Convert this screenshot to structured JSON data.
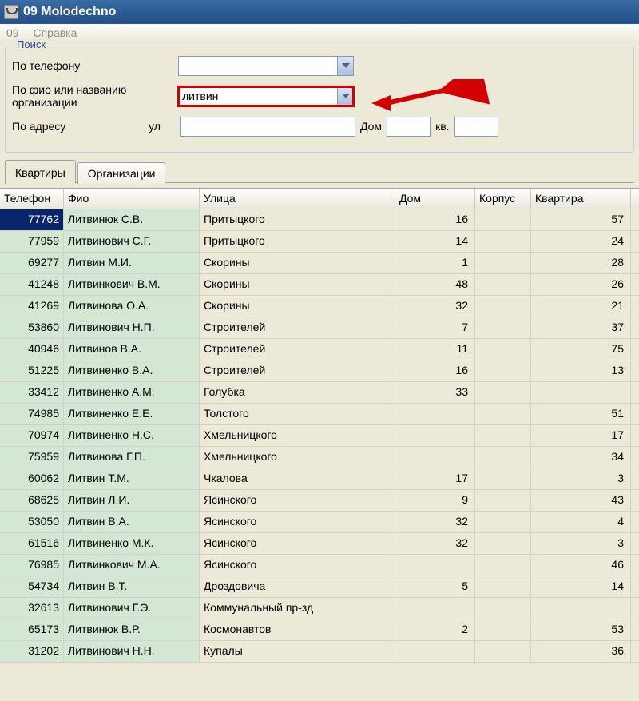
{
  "window": {
    "title": "09 Molodechno"
  },
  "menu": {
    "item_09": "09",
    "item_help": "Справка"
  },
  "search": {
    "legend": "Поиск",
    "by_phone_label": "По телефону",
    "by_phone_value": "",
    "by_name_label": "По фио или названию организации",
    "by_name_value": "литвин",
    "by_address_label": "По адресу",
    "street_prefix": "ул",
    "street_value": "",
    "house_label": "Дом",
    "house_value": "",
    "apt_label": "кв.",
    "apt_value": ""
  },
  "tabs": {
    "apartments": "Квартиры",
    "organizations": "Организации"
  },
  "columns": {
    "tel": "Телефон",
    "fio": "Фио",
    "street": "Улица",
    "dom": "Дом",
    "korp": "Корпус",
    "kv": "Квартира"
  },
  "rows": [
    {
      "tel": "77762",
      "fio": "Литвинюк С.В.",
      "street": "Притыцкого",
      "dom": "16",
      "korp": "",
      "kv": "57",
      "selected": true
    },
    {
      "tel": "77959",
      "fio": "Литвинович С.Г.",
      "street": "Притыцкого",
      "dom": "14",
      "korp": "",
      "kv": "24"
    },
    {
      "tel": "69277",
      "fio": "Литвин М.И.",
      "street": "Скорины",
      "dom": "1",
      "korp": "",
      "kv": "28"
    },
    {
      "tel": "41248",
      "fio": "Литвинкович В.М.",
      "street": "Скорины",
      "dom": "48",
      "korp": "",
      "kv": "26"
    },
    {
      "tel": "41269",
      "fio": "Литвинова О.А.",
      "street": "Скорины",
      "dom": "32",
      "korp": "",
      "kv": "21"
    },
    {
      "tel": "53860",
      "fio": "Литвинович Н.П.",
      "street": "Строителей",
      "dom": "7",
      "korp": "",
      "kv": "37"
    },
    {
      "tel": "40946",
      "fio": "Литвинов В.А.",
      "street": "Строителей",
      "dom": "11",
      "korp": "",
      "kv": "75"
    },
    {
      "tel": "51225",
      "fio": "Литвиненко В.А.",
      "street": "Строителей",
      "dom": "16",
      "korp": "",
      "kv": "13"
    },
    {
      "tel": "33412",
      "fio": "Литвиненко А.М.",
      "street": "Голубка",
      "dom": "33",
      "korp": "",
      "kv": ""
    },
    {
      "tel": "74985",
      "fio": "Литвиненко Е.Е.",
      "street": "Толстого",
      "dom": "",
      "korp": "",
      "kv": "51"
    },
    {
      "tel": "70974",
      "fio": "Литвиненко Н.С.",
      "street": "Хмельницкого",
      "dom": "",
      "korp": "",
      "kv": "17"
    },
    {
      "tel": "75959",
      "fio": "Литвинова Г.П.",
      "street": "Хмельницкого",
      "dom": "",
      "korp": "",
      "kv": "34"
    },
    {
      "tel": "60062",
      "fio": "Литвин Т.М.",
      "street": "Чкалова",
      "dom": "17",
      "korp": "",
      "kv": "3"
    },
    {
      "tel": "68625",
      "fio": "Литвин Л.И.",
      "street": "Ясинского",
      "dom": "9",
      "korp": "",
      "kv": "43"
    },
    {
      "tel": "53050",
      "fio": "Литвин В.А.",
      "street": "Ясинского",
      "dom": "32",
      "korp": "",
      "kv": "4"
    },
    {
      "tel": "61516",
      "fio": "Литвиненко М.К.",
      "street": "Ясинского",
      "dom": "32",
      "korp": "",
      "kv": "3"
    },
    {
      "tel": "76985",
      "fio": "Литвинкович М.А.",
      "street": "Ясинского",
      "dom": "",
      "korp": "",
      "kv": "46"
    },
    {
      "tel": "54734",
      "fio": "Литвин В.Т.",
      "street": "Дроздовича",
      "dom": "5",
      "korp": "",
      "kv": "14"
    },
    {
      "tel": "32613",
      "fio": "Литвинович Г.Э.",
      "street": "Коммунальный пр-зд",
      "dom": "",
      "korp": "",
      "kv": ""
    },
    {
      "tel": "65173",
      "fio": "Литвинюк В.Р.",
      "street": "Космонавтов",
      "dom": "2",
      "korp": "",
      "kv": "53"
    },
    {
      "tel": "31202",
      "fio": "Литвинович Н.Н.",
      "street": "Купалы",
      "dom": "",
      "korp": "",
      "kv": "36"
    }
  ]
}
